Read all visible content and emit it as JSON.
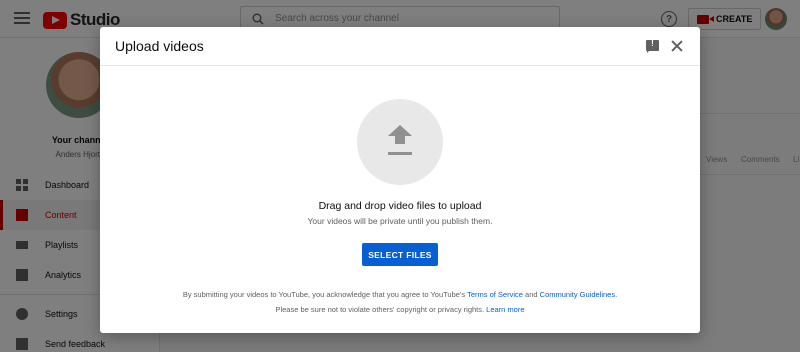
{
  "app": {
    "logo_text": "Studio"
  },
  "search": {
    "placeholder": "Search across your channel"
  },
  "header": {
    "create_label": "CREATE"
  },
  "channel": {
    "title": "Your channel",
    "name": "Anders Hjorth"
  },
  "sidebar": {
    "items": [
      {
        "label": "Dashboard",
        "icon": "dashboard-icon"
      },
      {
        "label": "Content",
        "icon": "content-icon",
        "active": true
      },
      {
        "label": "Playlists",
        "icon": "playlists-icon"
      },
      {
        "label": "Analytics",
        "icon": "analytics-icon"
      },
      {
        "label": "Settings",
        "icon": "gear-icon"
      },
      {
        "label": "Send feedback",
        "icon": "feedback-icon"
      }
    ]
  },
  "background_table": {
    "columns": [
      "Views",
      "Comments",
      "Li"
    ]
  },
  "dialog": {
    "title": "Upload videos",
    "drag_text": "Drag and drop video files to upload",
    "private_text": "Your videos will be private until you publish them.",
    "select_label": "SELECT FILES",
    "legal_prefix": "By submitting your videos to YouTube, you acknowledge that you agree to YouTube's",
    "terms_link": "Terms of Service",
    "and_text": "and",
    "guidelines_link": "Community Guidelines.",
    "copyright_text": "Please be sure not to violate others' copyright or privacy rights.",
    "learn_more": "Learn more"
  },
  "colors": {
    "accent": "#065fd4",
    "brand": "#ff0000",
    "active": "#cc0000"
  }
}
